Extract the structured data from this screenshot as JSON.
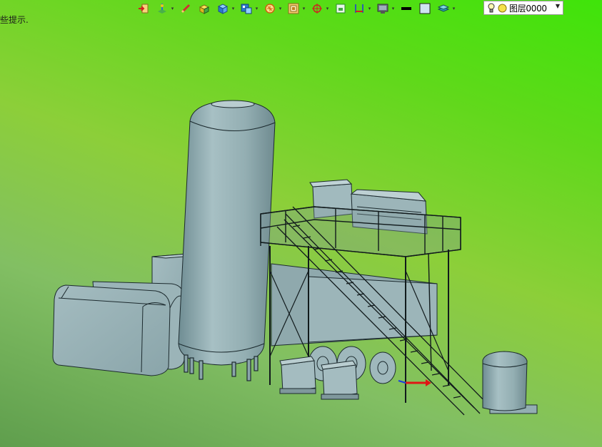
{
  "hint_text": "些提示.",
  "toolbar": {
    "buttons": [
      {
        "icon": "import-arrow-icon",
        "caret": false
      },
      {
        "icon": "clip-plane-icon",
        "caret": true
      },
      {
        "icon": "pencil-icon",
        "caret": false
      },
      {
        "icon": "yellow-cube-icon",
        "caret": false
      },
      {
        "icon": "view-cube-icon",
        "caret": true
      },
      {
        "icon": "views-icon",
        "caret": true
      },
      {
        "icon": "rotate-orbit-icon",
        "caret": true
      },
      {
        "icon": "render-mode-icon",
        "caret": true
      },
      {
        "icon": "target-pan-icon",
        "caret": true
      },
      {
        "icon": "fit-frame-icon",
        "caret": false
      },
      {
        "icon": "section-icon",
        "caret": true
      },
      {
        "icon": "display-monitor-icon",
        "caret": true
      },
      {
        "icon": "line-color-icon",
        "caret": false
      },
      {
        "icon": "fill-color-icon",
        "caret": false
      },
      {
        "icon": "layers-stack-icon",
        "caret": true
      }
    ]
  },
  "layer": {
    "current": "图层0000",
    "icons": [
      "lightbulb-icon",
      "sun-icon"
    ]
  },
  "colors": {
    "background_top": "#3fe40a",
    "background_bottom": "#5f9e4d",
    "model_fill": "#93aeb2",
    "model_edge": "#1c2a2e"
  }
}
